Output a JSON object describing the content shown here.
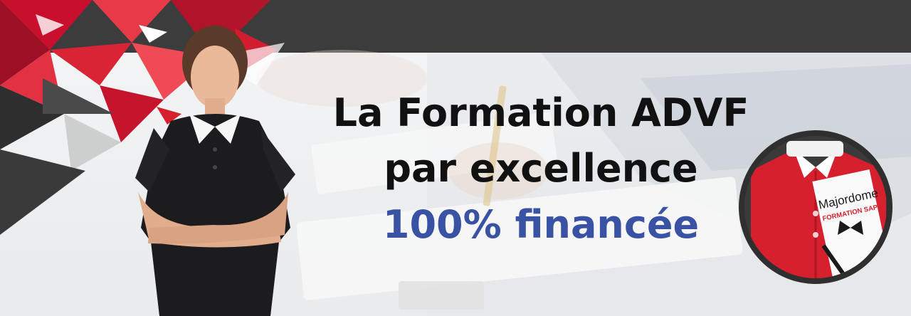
{
  "headline": {
    "line1": "La Formation ADVF",
    "line2": "par excellence",
    "line3": "100% financée",
    "highlight_color": "#3a52a3"
  },
  "logo": {
    "brand": "Majordome",
    "tagline": "FORMATION SAP",
    "brand_color": "#d6202e"
  },
  "icons": [
    "woman-photo",
    "triangle-pattern",
    "shirt-logo-icon"
  ]
}
